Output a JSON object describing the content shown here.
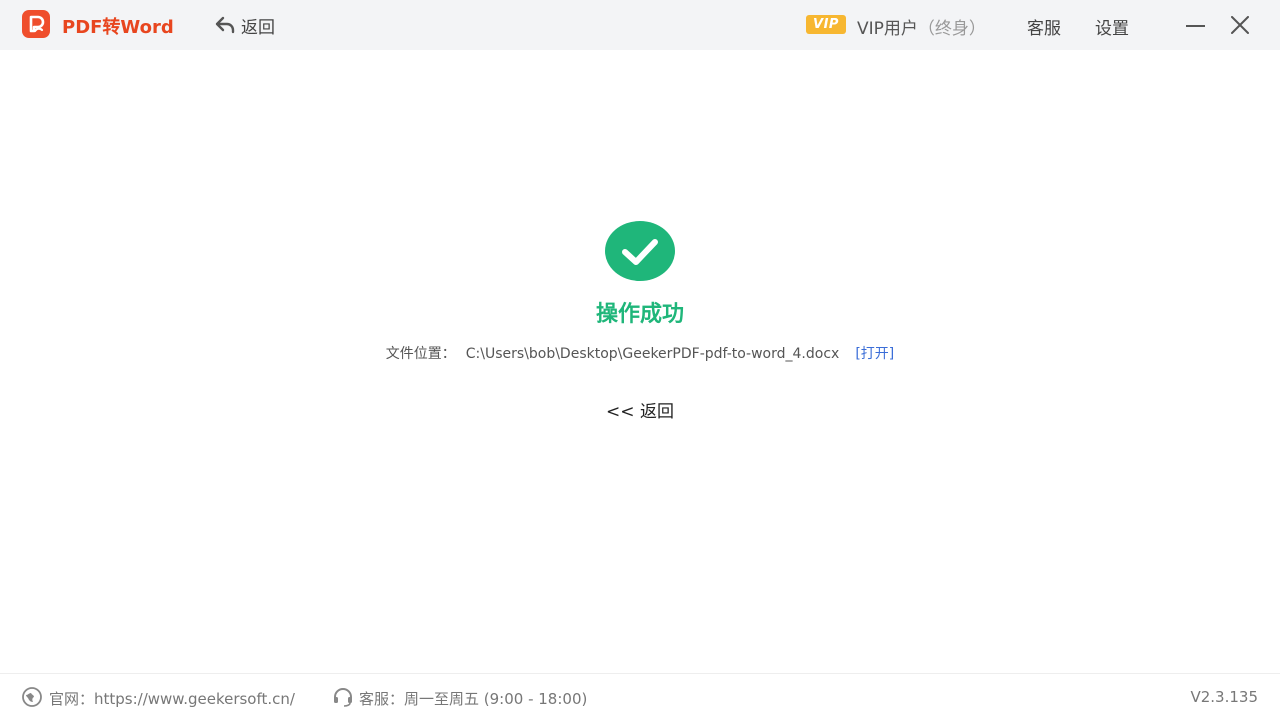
{
  "header": {
    "app_name": "PDF转Word",
    "back_label": "返回",
    "vip_badge": "VIP",
    "vip_user": "VIP用户",
    "vip_status": "（终身）",
    "customer_service": "客服",
    "settings": "设置"
  },
  "result": {
    "title": "操作成功",
    "file_location_label": "文件位置：",
    "file_path": "C:\\Users\\bob\\Desktop\\GeekerPDF-pdf-to-word_4.docx",
    "open_link": "[打开]",
    "back_link": "<< 返回"
  },
  "footer": {
    "website": "官网：https://www.geekersoft.cn/",
    "service_hours": "客服：周一至周五 (9:00 - 18:00)",
    "version": "V2.3.135"
  },
  "colors": {
    "brand": "#e8461f",
    "success": "#1fb67a",
    "link": "#3b6ed8",
    "vip": "#f7b731"
  }
}
